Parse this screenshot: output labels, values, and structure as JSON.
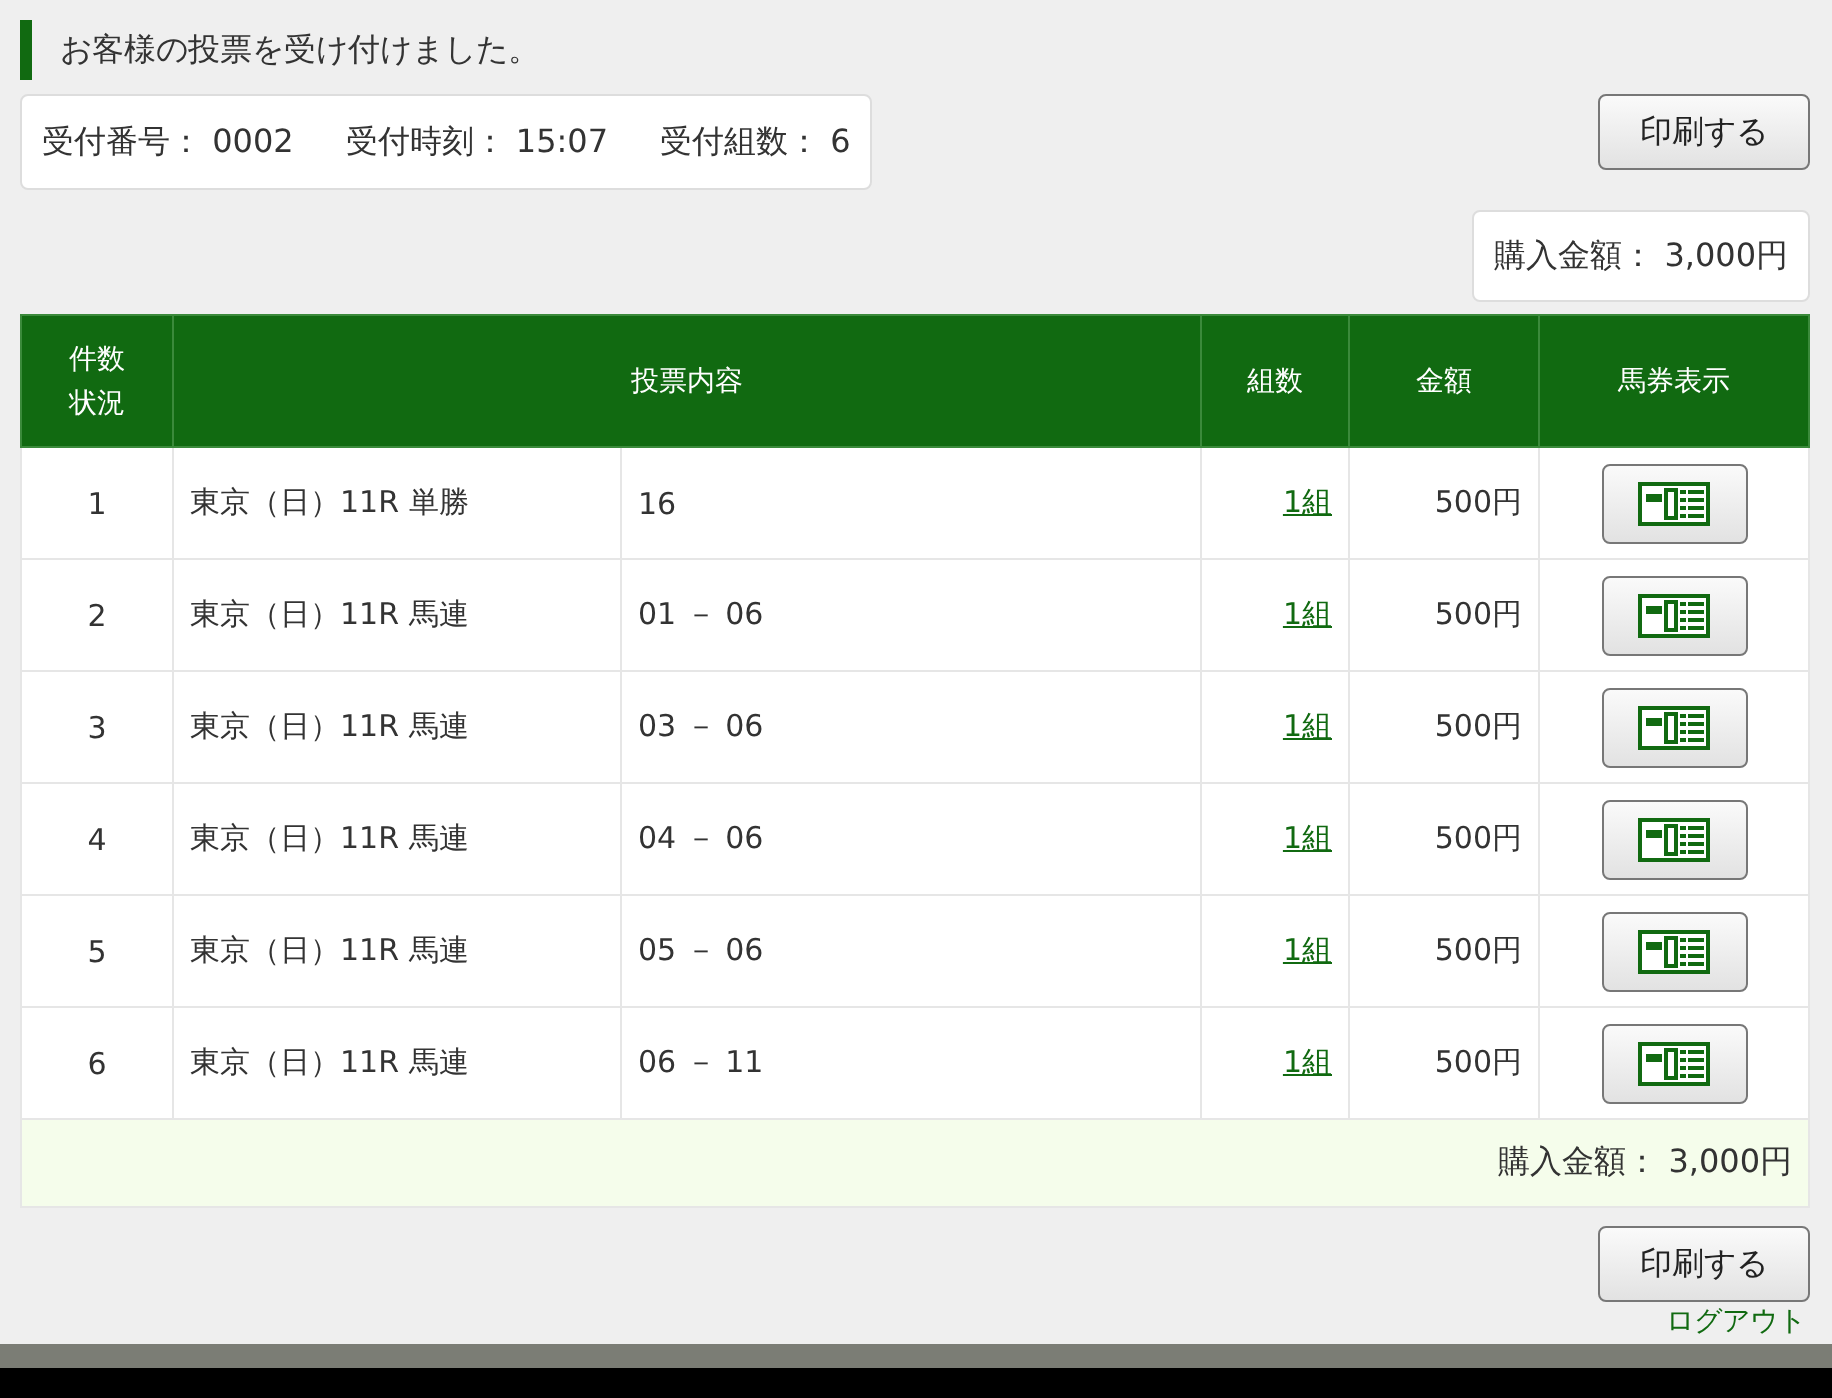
{
  "message": "お客様の投票を受け付けました。",
  "receipt": [
    {
      "label": "受付番号：",
      "value": "0002"
    },
    {
      "label": "受付時刻：",
      "value": "15:07"
    },
    {
      "label": "受付組数：",
      "value": "6"
    }
  ],
  "print_button": "印刷する",
  "total_top": {
    "label": "購入金額：",
    "value": "3,000円"
  },
  "table": {
    "columns": [
      "件数状況",
      "投票内容",
      "組数",
      "金額",
      "馬券表示"
    ],
    "rows": [
      {
        "no": "1",
        "race": "東京（日）11R 単勝",
        "selection": "16",
        "count": "1組",
        "amount": "500円"
      },
      {
        "no": "2",
        "race": "東京（日）11R 馬連",
        "selection": "01 － 06",
        "count": "1組",
        "amount": "500円"
      },
      {
        "no": "3",
        "race": "東京（日）11R 馬連",
        "selection": "03 － 06",
        "count": "1組",
        "amount": "500円"
      },
      {
        "no": "4",
        "race": "東京（日）11R 馬連",
        "selection": "04 － 06",
        "count": "1組",
        "amount": "500円"
      },
      {
        "no": "5",
        "race": "東京（日）11R 馬連",
        "selection": "05 － 06",
        "count": "1組",
        "amount": "500円"
      },
      {
        "no": "6",
        "race": "東京（日）11R 馬連",
        "selection": "06 － 11",
        "count": "1組",
        "amount": "500円"
      }
    ],
    "total": {
      "label": "購入金額：",
      "value": "3,000円"
    }
  },
  "print_button_bottom": "印刷する",
  "logout": "ログアウト"
}
